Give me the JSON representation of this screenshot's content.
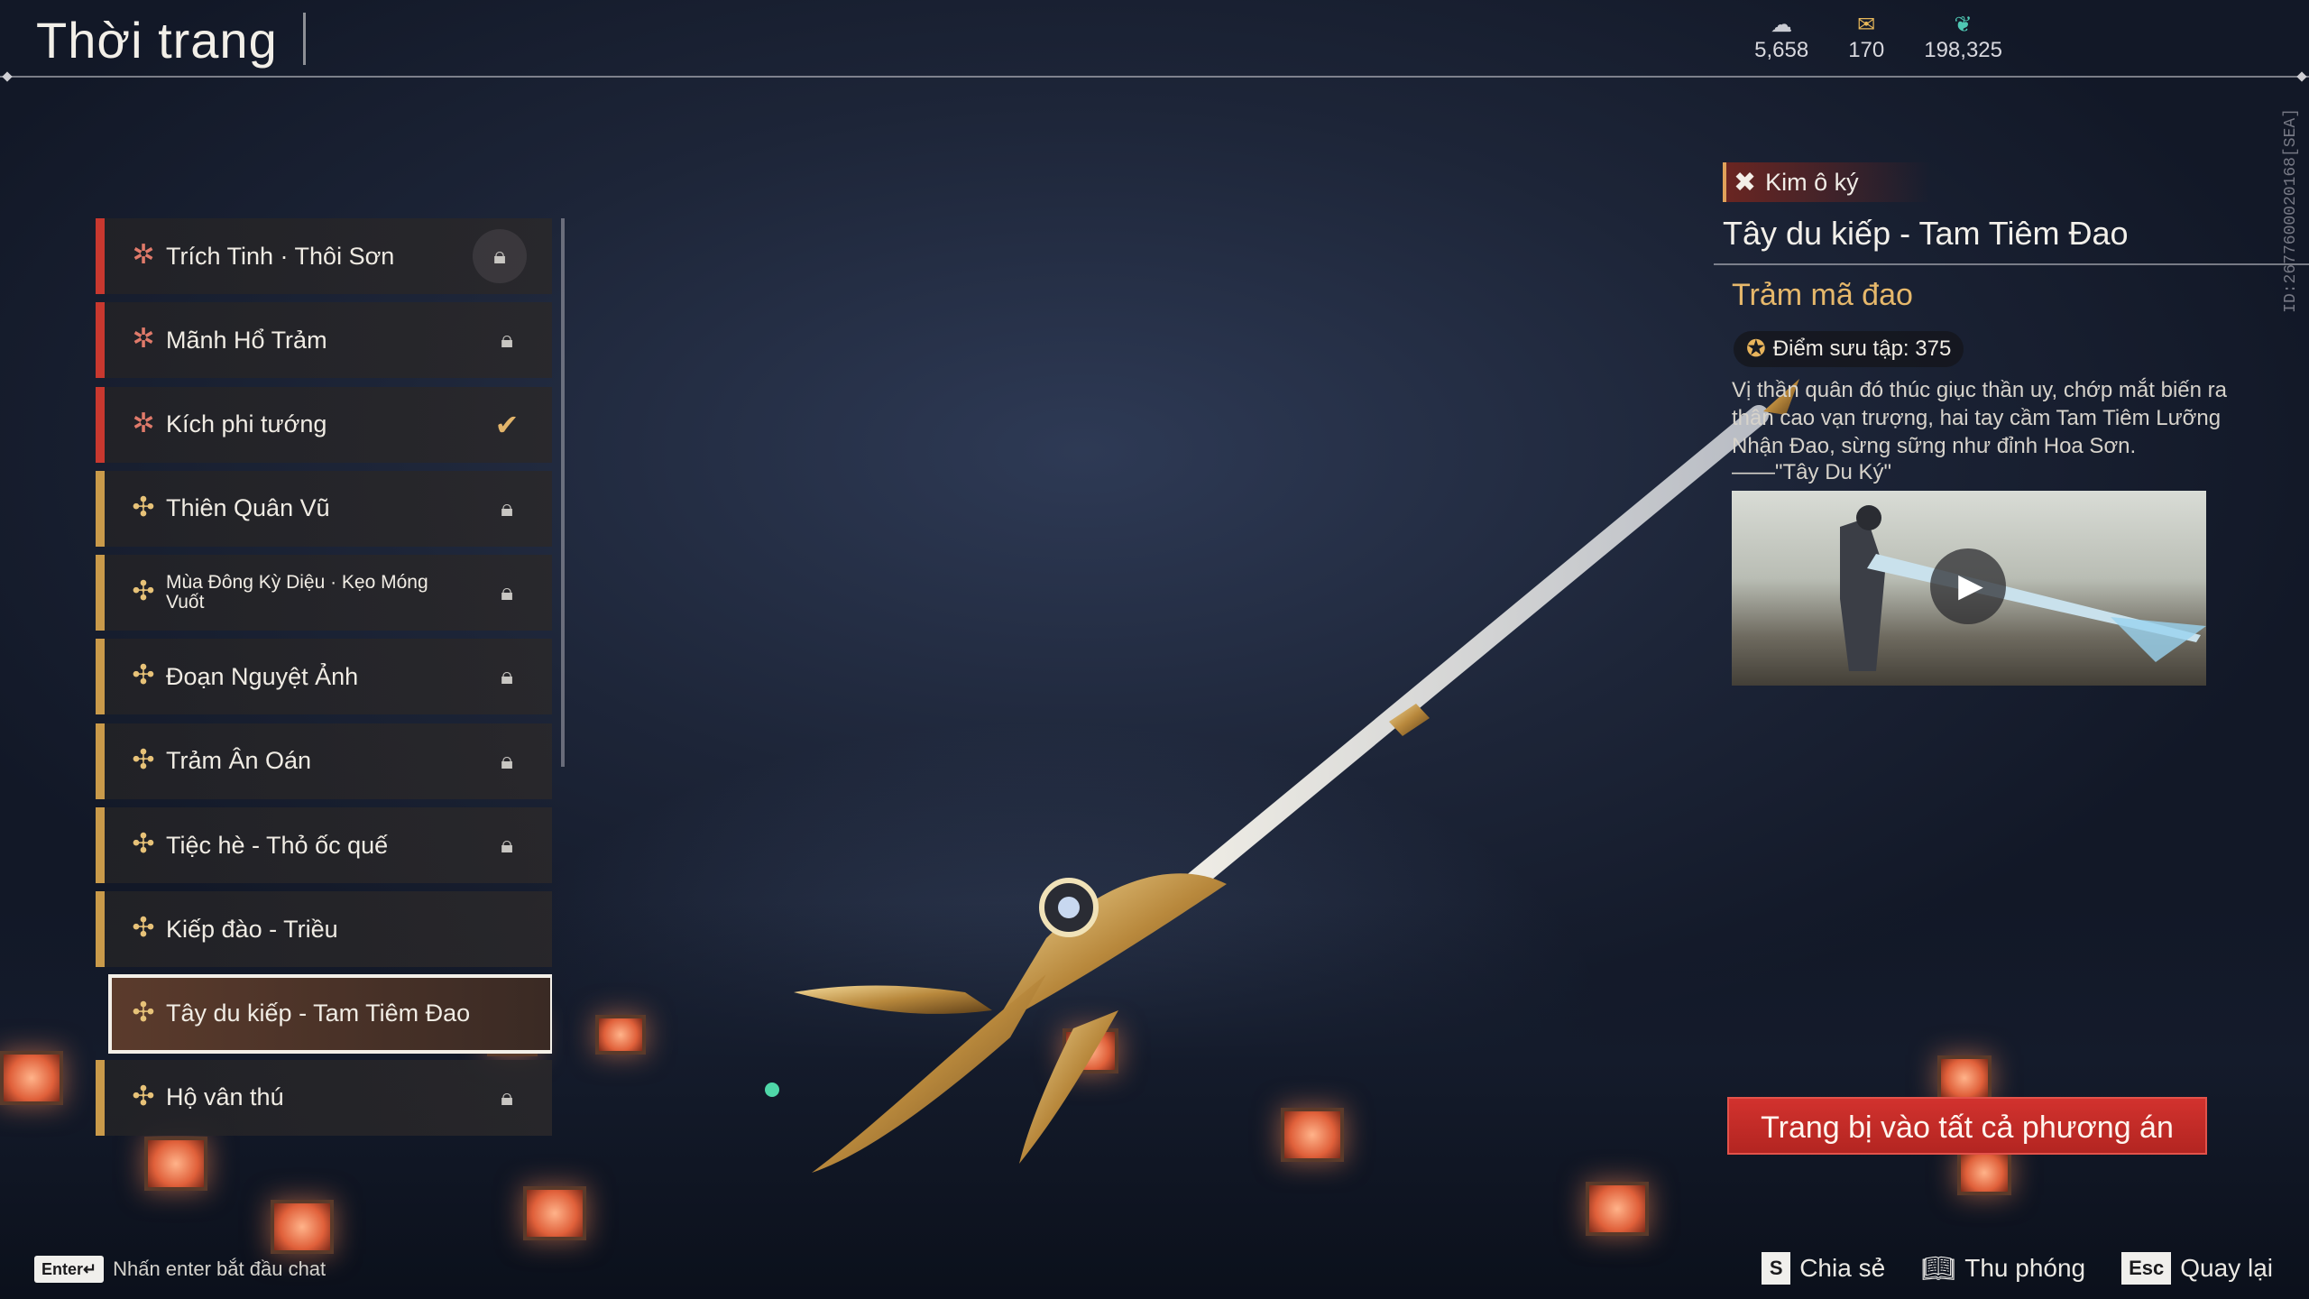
{
  "header": {
    "title": "Thời trang",
    "currencies": [
      {
        "icon": "cloud-coin-icon",
        "value": "5,658"
      },
      {
        "icon": "gold-ticket-icon",
        "value": "170"
      },
      {
        "icon": "jade-feather-icon",
        "value": "198,325"
      }
    ]
  },
  "list": {
    "items": [
      {
        "label": "Trích Tinh · Thôi Sơn",
        "tier": "red",
        "state": "locked-ring"
      },
      {
        "label": "Mãnh Hổ Trảm",
        "tier": "red",
        "state": "locked"
      },
      {
        "label": "Kích phi tướng",
        "tier": "red",
        "state": "owned"
      },
      {
        "label": "Thiên Quân Vũ",
        "tier": "gold",
        "state": "locked"
      },
      {
        "label": "Mùa Đông Kỳ Diệu · Kẹo Móng Vuốt",
        "tier": "gold",
        "state": "locked"
      },
      {
        "label": "Đoạn Nguyệt Ảnh",
        "tier": "gold",
        "state": "locked"
      },
      {
        "label": "Trảm Ân Oán",
        "tier": "gold",
        "state": "locked"
      },
      {
        "label": "Tiệc hè - Thỏ ốc quế",
        "tier": "gold",
        "state": "locked"
      },
      {
        "label": "Kiếp đào - Triều",
        "tier": "gold",
        "state": "none"
      },
      {
        "label": "Tây du kiếp - Tam Tiêm Đao",
        "tier": "gold",
        "state": "selected"
      },
      {
        "label": "Hộ vân thú",
        "tier": "gold",
        "state": "locked"
      }
    ]
  },
  "detail": {
    "tag": "Kim ô ký",
    "name": "Tây du kiếp - Tam Tiêm Đao",
    "subname": "Trảm mã đao",
    "points_label": "Điểm sưu tập: 375",
    "description": "Vị thần quân đó thúc giục thần uy, chớp mắt biến ra thân cao vạn trượng, hai tay cầm Tam Tiêm Lưỡng Nhận Đao, sừng sững như đỉnh Hoa Sơn.",
    "quote": "——\"Tây Du Ký\"",
    "equip_button": "Trang bị vào tất cả phương án"
  },
  "side_id": "ID:2677600020168[SEA]",
  "footer": {
    "chat_key": "Enter↵",
    "chat_hint": "Nhấn enter bắt đầu chat",
    "actions": [
      {
        "key": "S",
        "label": "Chia sẻ"
      },
      {
        "icon": "zoom-book-icon",
        "label": "Thu phóng"
      },
      {
        "key": "Esc",
        "label": "Quay lại"
      }
    ]
  },
  "colors": {
    "red_tier": "#c8382f",
    "gold_tier": "#c99a4a",
    "accent_gold": "#e6b86b",
    "equip_button": "#c52c28"
  }
}
